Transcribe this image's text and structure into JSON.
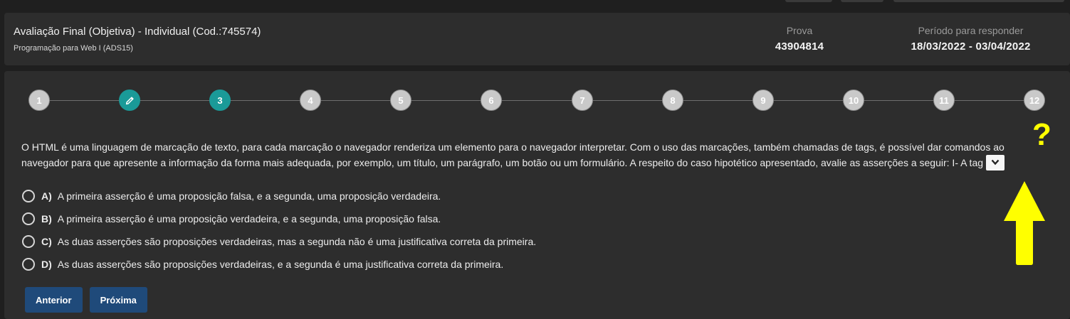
{
  "header": {
    "title": "Avaliação Final (Objetiva) - Individual (Cod.:745574)",
    "subtitle": "Programação para Web I (ADS15)",
    "prova_label": "Prova",
    "prova_value": "43904814",
    "periodo_label": "Período para responder",
    "periodo_value": "18/03/2022 - 03/04/2022"
  },
  "stepper": {
    "steps": [
      "1",
      "",
      "3",
      "4",
      "5",
      "6",
      "7",
      "8",
      "9",
      "10",
      "11",
      "12"
    ],
    "current": "3",
    "edited_step_icon": "pencil-icon"
  },
  "question": {
    "text_line1": "O HTML é uma linguagem de marcação de texto, para cada marcação o navegador renderiza um elemento para o navegador interpretar. Com o uso das marcações, também chamadas de tags, é possível dar comandos ao",
    "text_line2": "navegador para que apresente a informação da forma mais adequada, por exemplo, um título, um parágrafo, um botão ou um formulário. A respeito do caso hipotético apresentado, avalie as asserções a seguir: I- A tag"
  },
  "options": [
    {
      "letter": "A)",
      "text": "A primeira asserção é uma proposição falsa, e a segunda, uma proposição verdadeira."
    },
    {
      "letter": "B)",
      "text": "A primeira asserção é uma proposição verdadeira, e a segunda, uma proposição falsa."
    },
    {
      "letter": "C)",
      "text": "As duas asserções são proposições verdadeiras, mas a segunda não é uma justificativa correta da primeira."
    },
    {
      "letter": "D)",
      "text": "As duas asserções são proposições verdadeiras, e a segunda é uma justificativa correta da primeira."
    }
  ],
  "buttons": {
    "previous": "Anterior",
    "next": "Próxima"
  },
  "annotation": {
    "mark": "?",
    "color": "#ffff00"
  },
  "colors": {
    "accent": "#1a9a98",
    "button": "#1f4a7a"
  }
}
